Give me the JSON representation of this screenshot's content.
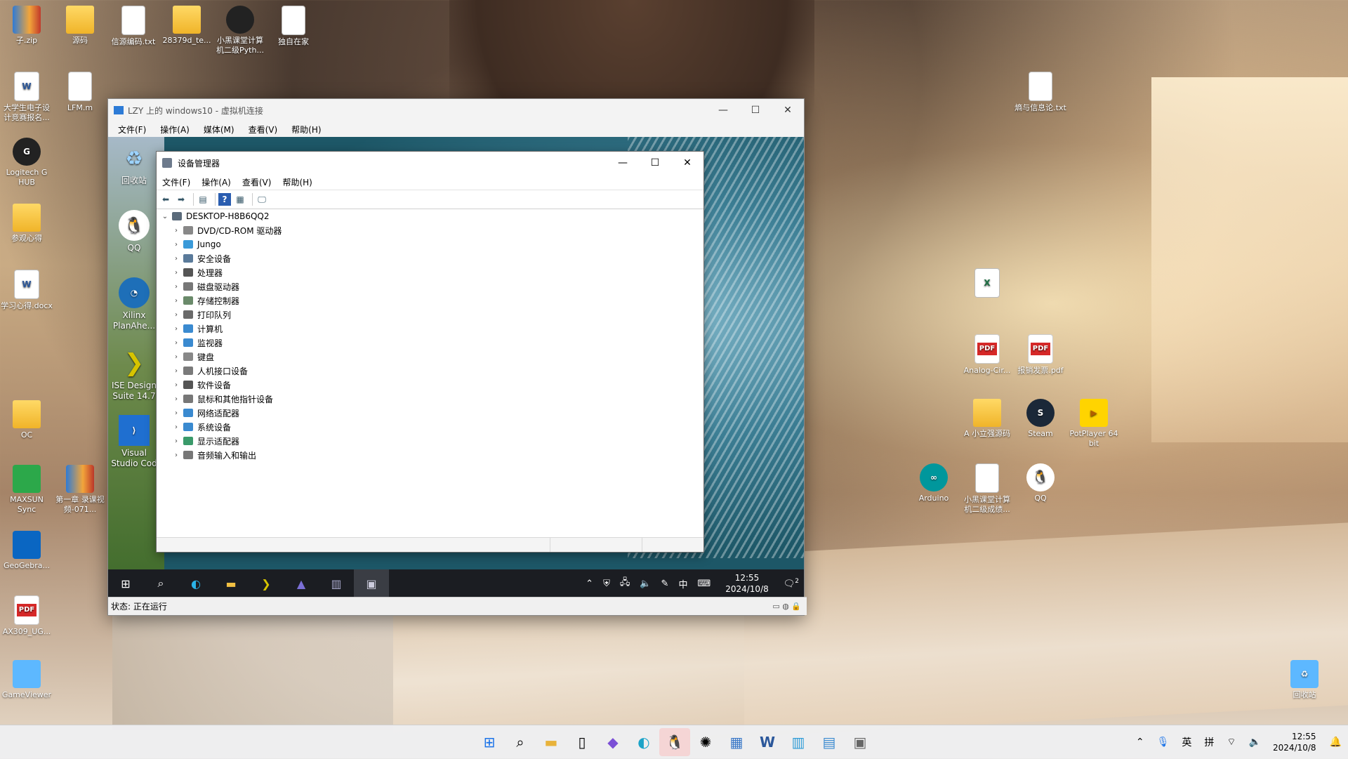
{
  "desktop": {
    "left_icons": [
      {
        "label": "子.zip",
        "kind": "zip"
      },
      {
        "label": "源码",
        "kind": "folder"
      },
      {
        "label": "信源编码.txt",
        "kind": "doc"
      },
      {
        "label": "28379d_te...",
        "kind": "folder"
      },
      {
        "label": "小黑课堂计算机二级Pyth...",
        "kind": "dark"
      },
      {
        "label": "独自在家",
        "kind": "doc"
      },
      {
        "label": "大学生电子设计竞赛报名...",
        "kind": "word"
      },
      {
        "label": "LFM.m",
        "kind": "doc"
      },
      {
        "label": "Logitech G HUB",
        "kind": "dark"
      },
      {
        "label": "参观心得",
        "kind": "folder"
      },
      {
        "label": "学习心得.docx",
        "kind": "word"
      },
      {
        "label": "OC",
        "kind": "folder"
      },
      {
        "label": "MAXSUN Sync",
        "kind": "green"
      },
      {
        "label": "第一章 录课视频-071...",
        "kind": "zip"
      },
      {
        "label": "GeoGebra...",
        "kind": "blue"
      },
      {
        "label": "AX309_UG...",
        "kind": "pdf"
      },
      {
        "label": "GameViewer",
        "kind": "rec"
      }
    ],
    "right_icons": [
      {
        "label": "熵与信息论.txt",
        "kind": "doc"
      },
      {
        "label": "Analog-Cir...",
        "kind": "pdf"
      },
      {
        "label": "报销发票.pdf",
        "kind": "pdf"
      },
      {
        "label": "A 小立强源码",
        "kind": "folder"
      },
      {
        "label": "Steam",
        "kind": "steam"
      },
      {
        "label": "PotPlayer 64 bit",
        "kind": "yellow"
      },
      {
        "label": "Arduino",
        "kind": "ard"
      },
      {
        "label": "小黑课堂计算机二级成绩...",
        "kind": "doc"
      },
      {
        "label": "QQ",
        "kind": "qq"
      },
      {
        "label": "回收站",
        "kind": "rec"
      }
    ]
  },
  "vm": {
    "title": "LZY 上的 windows10 - 虚拟机连接",
    "menu": [
      "文件(F)",
      "操作(A)",
      "媒体(M)",
      "查看(V)",
      "帮助(H)"
    ],
    "status": "状态: 正在运行"
  },
  "guest": {
    "icons": [
      {
        "label": "回收站",
        "kind": "rec"
      },
      {
        "label": "QQ",
        "kind": "qq"
      },
      {
        "label": "Xilinx PlanAhe...",
        "kind": "blue"
      },
      {
        "label": "ISE Design Suite 14.7",
        "kind": "yellow"
      },
      {
        "label": "Visual Studio Cod",
        "kind": "vs"
      }
    ],
    "clock_time": "12:55",
    "clock_date": "2024/10/8",
    "ime": "中",
    "notif_count": "2"
  },
  "device_manager": {
    "title": "设备管理器",
    "menu": [
      "文件(F)",
      "操作(A)",
      "查看(V)",
      "帮助(H)"
    ],
    "root": "DESKTOP-H8B6QQ2",
    "nodes": [
      {
        "label": "DVD/CD-ROM 驱动器",
        "color": "#888888"
      },
      {
        "label": "Jungo",
        "color": "#3a9ad9"
      },
      {
        "label": "安全设备",
        "color": "#5a7a9a"
      },
      {
        "label": "处理器",
        "color": "#555555"
      },
      {
        "label": "磁盘驱动器",
        "color": "#777777"
      },
      {
        "label": "存储控制器",
        "color": "#6a8a6a"
      },
      {
        "label": "打印队列",
        "color": "#6a6a6a"
      },
      {
        "label": "计算机",
        "color": "#3a8ad0"
      },
      {
        "label": "监视器",
        "color": "#3a8ad0"
      },
      {
        "label": "键盘",
        "color": "#888888"
      },
      {
        "label": "人机接口设备",
        "color": "#7a7a7a"
      },
      {
        "label": "软件设备",
        "color": "#555555"
      },
      {
        "label": "鼠标和其他指针设备",
        "color": "#777777"
      },
      {
        "label": "网络适配器",
        "color": "#3a8ad0"
      },
      {
        "label": "系统设备",
        "color": "#3a8ad0"
      },
      {
        "label": "显示适配器",
        "color": "#3a9a6a"
      },
      {
        "label": "音频输入和输出",
        "color": "#777777"
      }
    ]
  },
  "taskbar": {
    "ime1": "英",
    "ime2": "拼",
    "clock_time": "12:55",
    "clock_date": "2024/10/8"
  }
}
